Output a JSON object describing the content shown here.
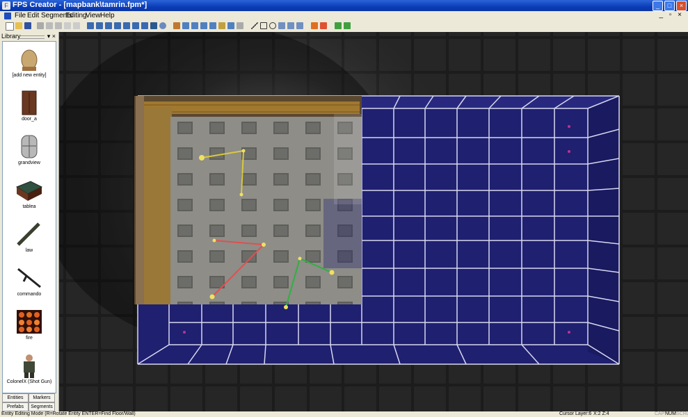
{
  "window": {
    "title": "FPS Creator - [mapbank\\tamrin.fpm*]"
  },
  "menu": [
    "File",
    "Edit",
    "Segments",
    "Editing",
    "View",
    "Help"
  ],
  "toolbar": {
    "icons": [
      "new-icon",
      "open-icon",
      "save-icon",
      "cut-icon",
      "copy-icon",
      "paste-icon",
      "undo-icon",
      "redo-icon",
      "view-icon",
      "layer-icon",
      "zoom-icon",
      "entity-icon",
      "waypoint-icon",
      "line-icon",
      "rect-icon",
      "circle-icon",
      "flag-icon",
      "build-icon",
      "test-icon"
    ]
  },
  "library": {
    "title": "Library",
    "entities": [
      {
        "name": "add-new-entity",
        "label": "[add new entity]"
      },
      {
        "name": "door_a",
        "label": "door_a"
      },
      {
        "name": "grandview",
        "label": "grandview"
      },
      {
        "name": "tablea",
        "label": "tablea"
      },
      {
        "name": "law",
        "label": "law"
      },
      {
        "name": "commando",
        "label": "commando"
      },
      {
        "name": "fire",
        "label": "fire"
      },
      {
        "name": "colonelx",
        "label": "ColonelX (Shot Gun)"
      }
    ],
    "tabs": {
      "entities": "Entities",
      "markers": "Markers",
      "prefabs": "Prefabs",
      "segments": "Segments"
    }
  },
  "status": {
    "mode": "Entity Editing Mode (R=Rotate Entity  ENTER=Find Floor/Wall)",
    "cursor_layer": "Cursor Layer:6",
    "coords": "X:2  Z:4",
    "cap": "CAP",
    "num": "NUM",
    "scrl": "SCRL"
  },
  "colors": {
    "floor": "#1e1f6b",
    "grid_line": "#d8d8f0",
    "wall_texture": "#8a8a85",
    "waypoint_red": "#e05050",
    "waypoint_green": "#30b040",
    "waypoint_yellow": "#d8c840"
  }
}
